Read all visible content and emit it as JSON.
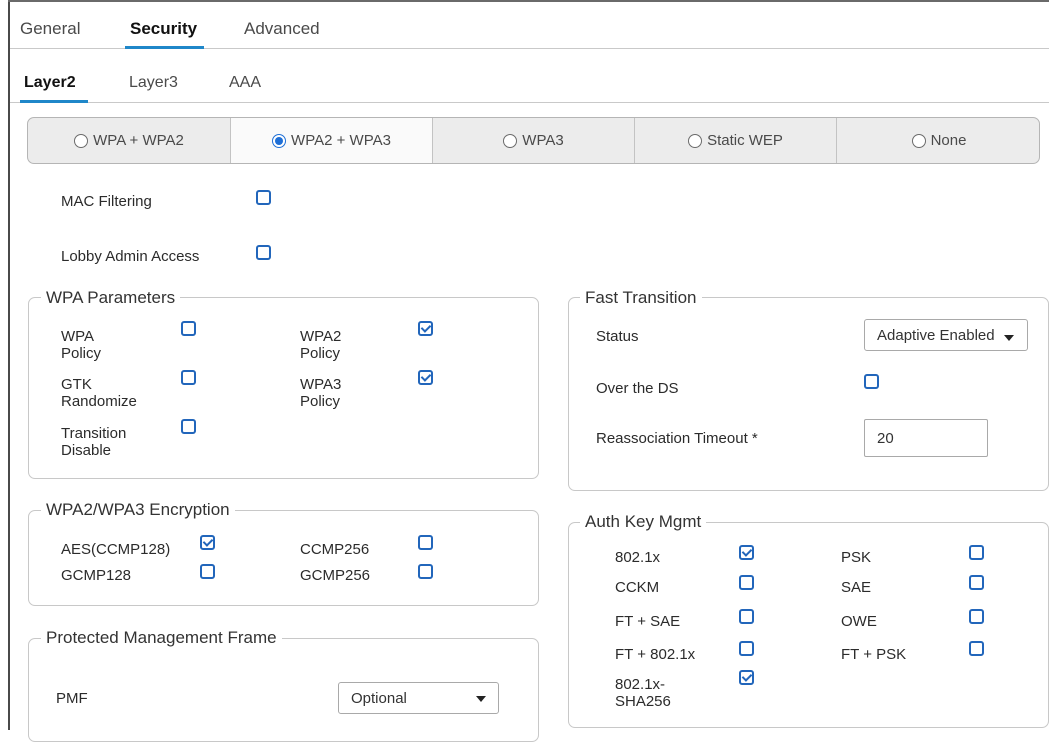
{
  "tabs": [
    {
      "label": "General"
    },
    {
      "label": "Security"
    },
    {
      "label": "Advanced"
    }
  ],
  "subtabs": [
    {
      "label": "Layer2"
    },
    {
      "label": "Layer3"
    },
    {
      "label": "AAA"
    }
  ],
  "security_modes": [
    {
      "label": "WPA + WPA2",
      "selected": false
    },
    {
      "label": "WPA2 + WPA3",
      "selected": true
    },
    {
      "label": "WPA3",
      "selected": false
    },
    {
      "label": "Static WEP",
      "selected": false
    },
    {
      "label": "None",
      "selected": false
    }
  ],
  "mac_filtering": {
    "label": "MAC Filtering",
    "checked": false
  },
  "lobby_admin": {
    "label": "Lobby Admin Access",
    "checked": false
  },
  "wpa_parameters": {
    "title": "WPA Parameters",
    "items": [
      {
        "label": "WPA\nPolicy",
        "checked": false
      },
      {
        "label": "WPA2\nPolicy",
        "checked": true
      },
      {
        "label": "GTK\nRandomize",
        "checked": false
      },
      {
        "label": "WPA3\nPolicy",
        "checked": true
      },
      {
        "label": "Transition\nDisable",
        "checked": false
      }
    ]
  },
  "encryption": {
    "title": "WPA2/WPA3 Encryption",
    "items": [
      {
        "label": "AES(CCMP128)",
        "checked": true
      },
      {
        "label": "CCMP256",
        "checked": false
      },
      {
        "label": "GCMP128",
        "checked": false
      },
      {
        "label": "GCMP256",
        "checked": false
      }
    ]
  },
  "pmf": {
    "title": "Protected Management Frame",
    "label": "PMF",
    "value": "Optional"
  },
  "fast_transition": {
    "title": "Fast Transition",
    "status_label": "Status",
    "status_value": "Adaptive Enabled",
    "over_ds_label": "Over the DS",
    "over_ds_checked": false,
    "reassoc_label": "Reassociation Timeout *",
    "reassoc_value": "20"
  },
  "auth_key_mgmt": {
    "title": "Auth Key Mgmt",
    "items": [
      {
        "label": "802.1x",
        "checked": true
      },
      {
        "label": "PSK",
        "checked": false
      },
      {
        "label": "CCKM",
        "checked": false
      },
      {
        "label": "SAE",
        "checked": false
      },
      {
        "label": "FT + SAE",
        "checked": false
      },
      {
        "label": "OWE",
        "checked": false
      },
      {
        "label": "FT + 802.1x",
        "checked": false
      },
      {
        "label": "FT + PSK",
        "checked": false
      },
      {
        "label": "802.1x-\nSHA256",
        "checked": true
      }
    ]
  },
  "colors": {
    "accent": "#1f87c9",
    "checkbox": "#2266bb",
    "radio": "#1f6fd6"
  }
}
